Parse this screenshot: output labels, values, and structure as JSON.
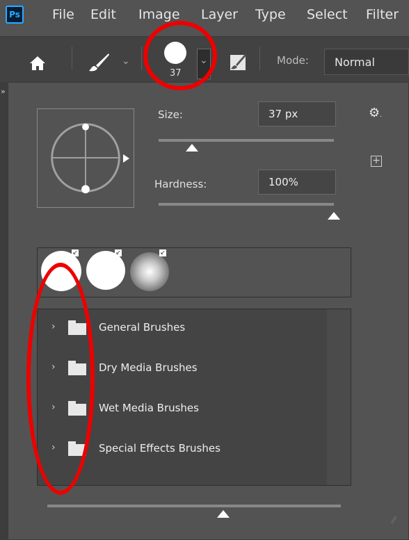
{
  "menubar": {
    "logo": "Ps",
    "items": [
      "File",
      "Edit",
      "Image",
      "Layer",
      "Type",
      "Select",
      "Filter"
    ]
  },
  "options_bar": {
    "brush_size": "37",
    "mode_label": "Mode:",
    "mode_value": "Normal"
  },
  "panel": {
    "size_label": "Size:",
    "size_value": "37 px",
    "size_level": 0.19,
    "hardness_label": "Hardness:",
    "hardness_value": "100%",
    "hardness_level": 1.0,
    "preview_size_level": 0.6,
    "recent_brushes": [
      "hard-round-large",
      "hard-round",
      "soft-round"
    ],
    "folders": [
      "General Brushes",
      "Dry Media Brushes",
      "Wet Media Brushes",
      "Special Effects Brushes"
    ]
  },
  "icons": {
    "home": "home-icon",
    "brush_tool": "brush-icon",
    "settings": "gear-icon",
    "new_preset": "plus-square-icon",
    "folder": "folder-icon",
    "expand": "chevron-right-icon"
  },
  "colors": {
    "annotation": "#ee0000",
    "panel_bg": "#535353",
    "ps_logo_bg": "#001e36",
    "ps_logo_fg": "#31a8ff"
  }
}
